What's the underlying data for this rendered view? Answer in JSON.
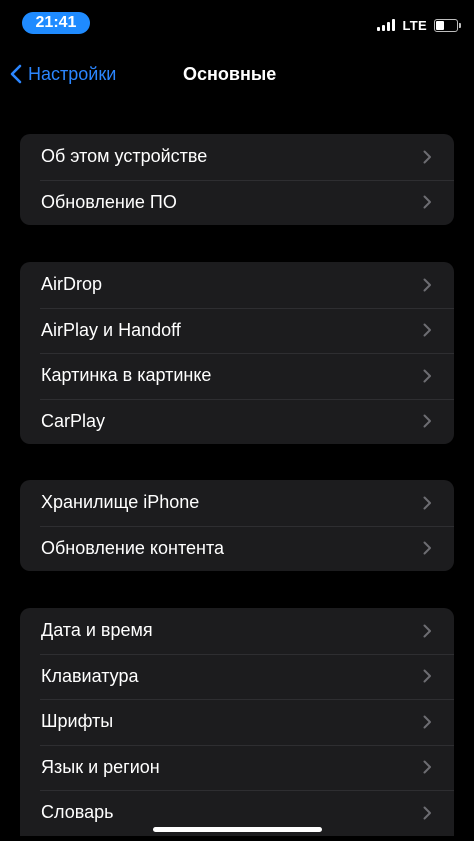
{
  "status_bar": {
    "time": "21:41",
    "network": "LTE",
    "time_pill_color": "#1f8bff"
  },
  "nav": {
    "back_label": "Настройки",
    "title": "Основные",
    "accent_color": "#2b86ff",
    "back_icon": "chevron-left-icon"
  },
  "groups": [
    {
      "items": [
        {
          "label": "Об этом устройстве"
        },
        {
          "label": "Обновление ПО"
        }
      ]
    },
    {
      "items": [
        {
          "label": "AirDrop"
        },
        {
          "label": "AirPlay и Handoff"
        },
        {
          "label": "Картинка в картинке"
        },
        {
          "label": "CarPlay"
        }
      ]
    },
    {
      "items": [
        {
          "label": "Хранилище iPhone"
        },
        {
          "label": "Обновление контента"
        }
      ]
    },
    {
      "items": [
        {
          "label": "Дата и время"
        },
        {
          "label": "Клавиатура"
        },
        {
          "label": "Шрифты"
        },
        {
          "label": "Язык и регион"
        },
        {
          "label": "Словарь"
        }
      ]
    }
  ],
  "row_icon": "chevron-right-icon"
}
